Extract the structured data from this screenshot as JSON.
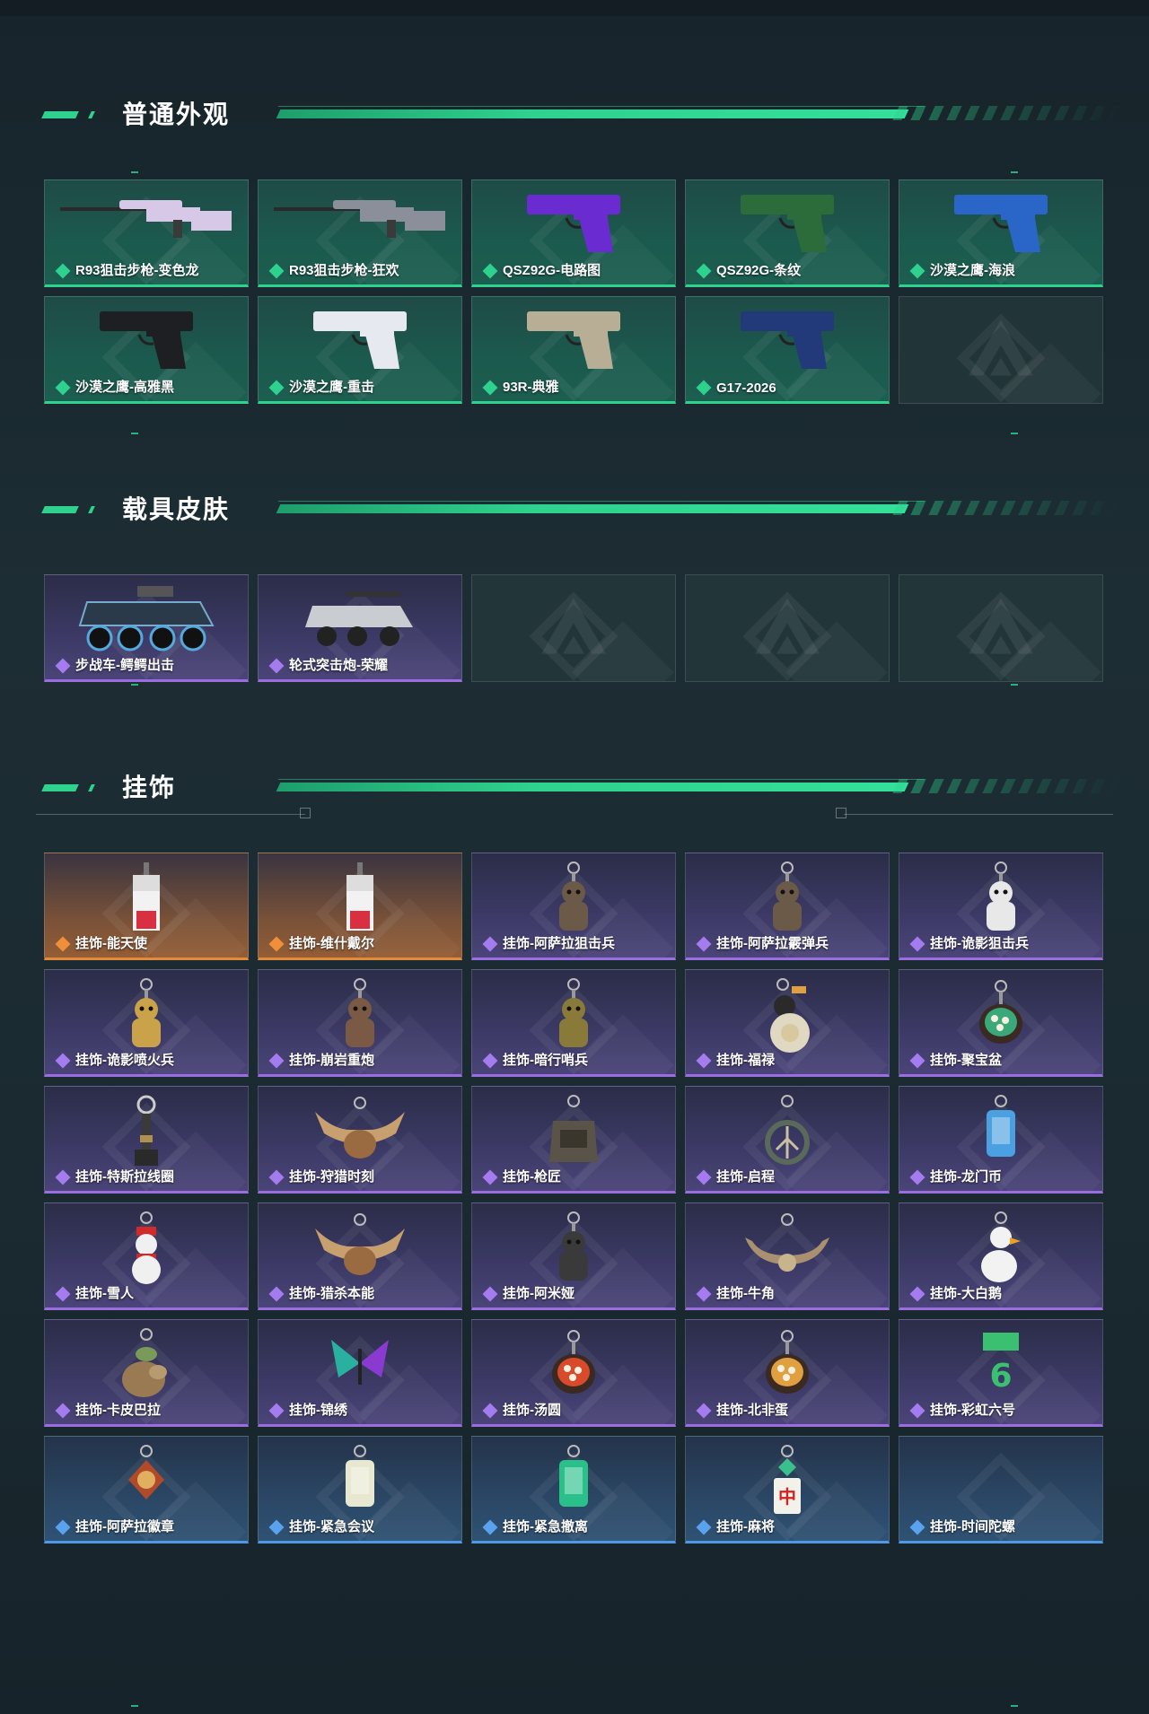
{
  "sections": [
    {
      "title": "普通外观",
      "items": [
        {
          "label": "R93狙击步枪-变色龙",
          "rarity": "green",
          "icon": "sniper-rifle-icon",
          "color": "#d8c8e8"
        },
        {
          "label": "R93狙击步枪-狂欢",
          "rarity": "green",
          "icon": "sniper-rifle-icon",
          "color": ""
        },
        {
          "label": "QSZ92G-电路图",
          "rarity": "green",
          "icon": "pistol-icon",
          "color": "#6a2bd0"
        },
        {
          "label": "QSZ92G-条纹",
          "rarity": "green",
          "icon": "pistol-icon",
          "color": "#2c6b3a"
        },
        {
          "label": "沙漠之鹰-海浪",
          "rarity": "green",
          "icon": "pistol-icon",
          "color": "#2a66c8"
        },
        {
          "label": "沙漠之鹰-高雅黑",
          "rarity": "green",
          "icon": "pistol-icon",
          "color": "#1e1f22"
        },
        {
          "label": "沙漠之鹰-重击",
          "rarity": "green",
          "icon": "pistol-icon",
          "color": "#e6eaf0"
        },
        {
          "label": "93R-典雅",
          "rarity": "green",
          "icon": "pistol-icon",
          "color": "#b8ae96"
        },
        {
          "label": "G17-2026",
          "rarity": "green",
          "icon": "pistol-icon",
          "color": "#223a7a"
        },
        {
          "label": "",
          "rarity": "empty",
          "icon": "placeholder-logo-icon",
          "color": ""
        }
      ]
    },
    {
      "title": "载具皮肤",
      "items": [
        {
          "label": "步战车-鳄鳄出击",
          "rarity": "purple",
          "icon": "armored-vehicle-icon",
          "color": "#2b3a4a"
        },
        {
          "label": "轮式突击炮-荣耀",
          "rarity": "purple",
          "icon": "assault-vehicle-icon",
          "color": "#c9ccd0"
        },
        {
          "label": "",
          "rarity": "empty",
          "icon": "placeholder-logo-icon",
          "color": ""
        },
        {
          "label": "",
          "rarity": "empty",
          "icon": "placeholder-logo-icon",
          "color": ""
        },
        {
          "label": "",
          "rarity": "empty",
          "icon": "placeholder-logo-icon",
          "color": ""
        }
      ]
    },
    {
      "title": "挂饰",
      "items": [
        {
          "label": "挂饰-能天使",
          "rarity": "orange",
          "icon": "charm-tag-icon",
          "color": "#d83040"
        },
        {
          "label": "挂饰-维什戴尔",
          "rarity": "orange",
          "icon": "charm-tag-icon",
          "color": "#d83040"
        },
        {
          "label": "挂饰-阿萨拉狙击兵",
          "rarity": "purple",
          "icon": "charm-figure-icon",
          "color": "#6b5a48"
        },
        {
          "label": "挂饰-阿萨拉霰弹兵",
          "rarity": "purple",
          "icon": "charm-figure-icon",
          "color": "#6b5a48"
        },
        {
          "label": "挂饰-诡影狙击兵",
          "rarity": "purple",
          "icon": "charm-figure-icon",
          "color": "#e8e8e8"
        },
        {
          "label": "挂饰-诡影喷火兵",
          "rarity": "purple",
          "icon": "charm-figure-icon",
          "color": "#c9a24a"
        },
        {
          "label": "挂饰-崩岩重炮",
          "rarity": "purple",
          "icon": "charm-figure-icon",
          "color": "#7a5a44"
        },
        {
          "label": "挂饰-暗行哨兵",
          "rarity": "purple",
          "icon": "charm-figure-icon",
          "color": "#8a7a3a"
        },
        {
          "label": "挂饰-福禄",
          "rarity": "purple",
          "icon": "charm-gourd-icon",
          "color": "#e0d8c0"
        },
        {
          "label": "挂饰-聚宝盆",
          "rarity": "purple",
          "icon": "charm-bowl-icon",
          "color": "#3aa878"
        },
        {
          "label": "挂饰-特斯拉线圈",
          "rarity": "purple",
          "icon": "charm-coil-icon",
          "color": "#3a3a3a"
        },
        {
          "label": "挂饰-狩猎时刻",
          "rarity": "purple",
          "icon": "charm-antler-icon",
          "color": "#c8a070"
        },
        {
          "label": "挂饰-枪匠",
          "rarity": "purple",
          "icon": "charm-bag-icon",
          "color": "#5a5448"
        },
        {
          "label": "挂饰-启程",
          "rarity": "purple",
          "icon": "charm-ring-icon",
          "color": "#5a6a5a"
        },
        {
          "label": "挂饰-龙门币",
          "rarity": "purple",
          "icon": "charm-card-icon",
          "color": "#4aa0e0"
        },
        {
          "label": "挂饰-雪人",
          "rarity": "purple",
          "icon": "charm-snowman-icon",
          "color": "#f0f0f0"
        },
        {
          "label": "挂饰-猎杀本能",
          "rarity": "purple",
          "icon": "charm-antler-icon",
          "color": "#c8a070"
        },
        {
          "label": "挂饰-阿米娅",
          "rarity": "purple",
          "icon": "charm-figure-icon",
          "color": "#3a3a3a"
        },
        {
          "label": "挂饰-牛角",
          "rarity": "purple",
          "icon": "charm-horn-icon",
          "color": "#a89070"
        },
        {
          "label": "挂饰-大白鹅",
          "rarity": "purple",
          "icon": "charm-goose-icon",
          "color": "#f2f2f2"
        },
        {
          "label": "挂饰-卡皮巴拉",
          "rarity": "purple",
          "icon": "charm-capybara-icon",
          "color": "#9a7a52"
        },
        {
          "label": "挂饰-锦绣",
          "rarity": "purple",
          "icon": "charm-butterfly-icon",
          "color": "#2ab0a0"
        },
        {
          "label": "挂饰-汤圆",
          "rarity": "purple",
          "icon": "charm-bowl-icon",
          "color": "#d84a2a"
        },
        {
          "label": "挂饰-北非蛋",
          "rarity": "purple",
          "icon": "charm-bowl-icon",
          "color": "#e0a040"
        },
        {
          "label": "挂饰-彩虹六号",
          "rarity": "purple",
          "icon": "charm-six-icon",
          "color": "#3ac070"
        },
        {
          "label": "挂饰-阿萨拉徽章",
          "rarity": "blue",
          "icon": "charm-badge-icon",
          "color": "#b04a2a"
        },
        {
          "label": "挂饰-紧急会议",
          "rarity": "blue",
          "icon": "charm-card-icon",
          "color": "#e8e8d0"
        },
        {
          "label": "挂饰-紧急撤离",
          "rarity": "blue",
          "icon": "charm-card-icon",
          "color": "#2ac08a"
        },
        {
          "label": "挂饰-麻将",
          "rarity": "blue",
          "icon": "charm-mahjong-icon",
          "color": "#d82020"
        },
        {
          "label": "挂饰-时间陀螺",
          "rarity": "blue",
          "icon": "charm-top-icon",
          "color": ""
        }
      ]
    }
  ],
  "colors": {
    "accent_green": "#2fd18e",
    "rarity_green": "#2fd18e",
    "rarity_purple": "#9a6ee0",
    "rarity_orange": "#e38a3a",
    "rarity_blue": "#4e98e6"
  }
}
